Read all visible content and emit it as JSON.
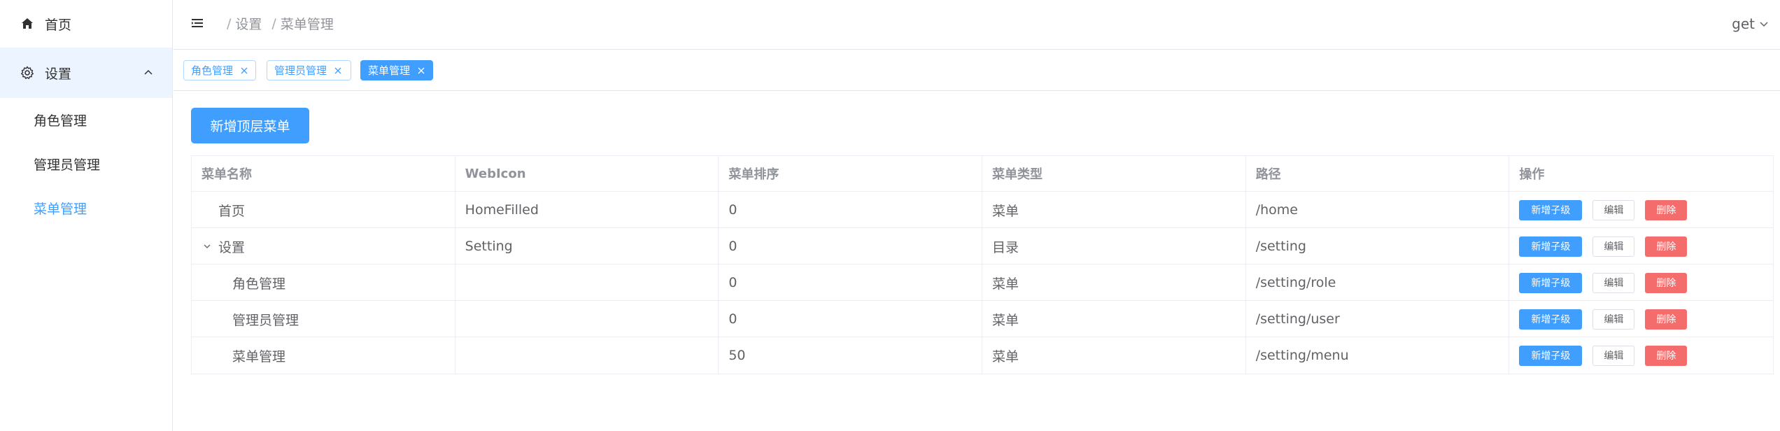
{
  "sidebar": {
    "home_label": "首页",
    "settings_label": "设置",
    "items": [
      {
        "label": "角色管理",
        "active": false
      },
      {
        "label": "管理员管理",
        "active": false
      },
      {
        "label": "菜单管理",
        "active": true
      }
    ]
  },
  "header": {
    "breadcrumb": [
      "设置",
      "菜单管理"
    ],
    "user": "get"
  },
  "tags": [
    {
      "label": "角色管理",
      "active": false
    },
    {
      "label": "管理员管理",
      "active": false
    },
    {
      "label": "菜单管理",
      "active": true
    }
  ],
  "main": {
    "add_top_menu_label": "新增顶层菜单"
  },
  "table": {
    "columns": [
      "菜单名称",
      "WebIcon",
      "菜单排序",
      "菜单类型",
      "路径",
      "操作"
    ],
    "rows": [
      {
        "name": "首页",
        "icon": "HomeFilled",
        "order": "0",
        "type": "菜单",
        "path": "/home"
      },
      {
        "name": "设置",
        "icon": "Setting",
        "order": "0",
        "type": "目录",
        "path": "/setting"
      },
      {
        "name": "角色管理",
        "icon": "",
        "order": "0",
        "type": "菜单",
        "path": "/setting/role"
      },
      {
        "name": "管理员管理",
        "icon": "",
        "order": "0",
        "type": "菜单",
        "path": "/setting/user"
      },
      {
        "name": "菜单管理",
        "icon": "",
        "order": "50",
        "type": "菜单",
        "path": "/setting/menu"
      }
    ],
    "actions": {
      "add_child": "新增子级",
      "edit": "编辑",
      "delete": "删除"
    }
  },
  "colors": {
    "primary": "#409eff",
    "danger": "#f56c6c",
    "active_bg": "#ecf5ff"
  }
}
